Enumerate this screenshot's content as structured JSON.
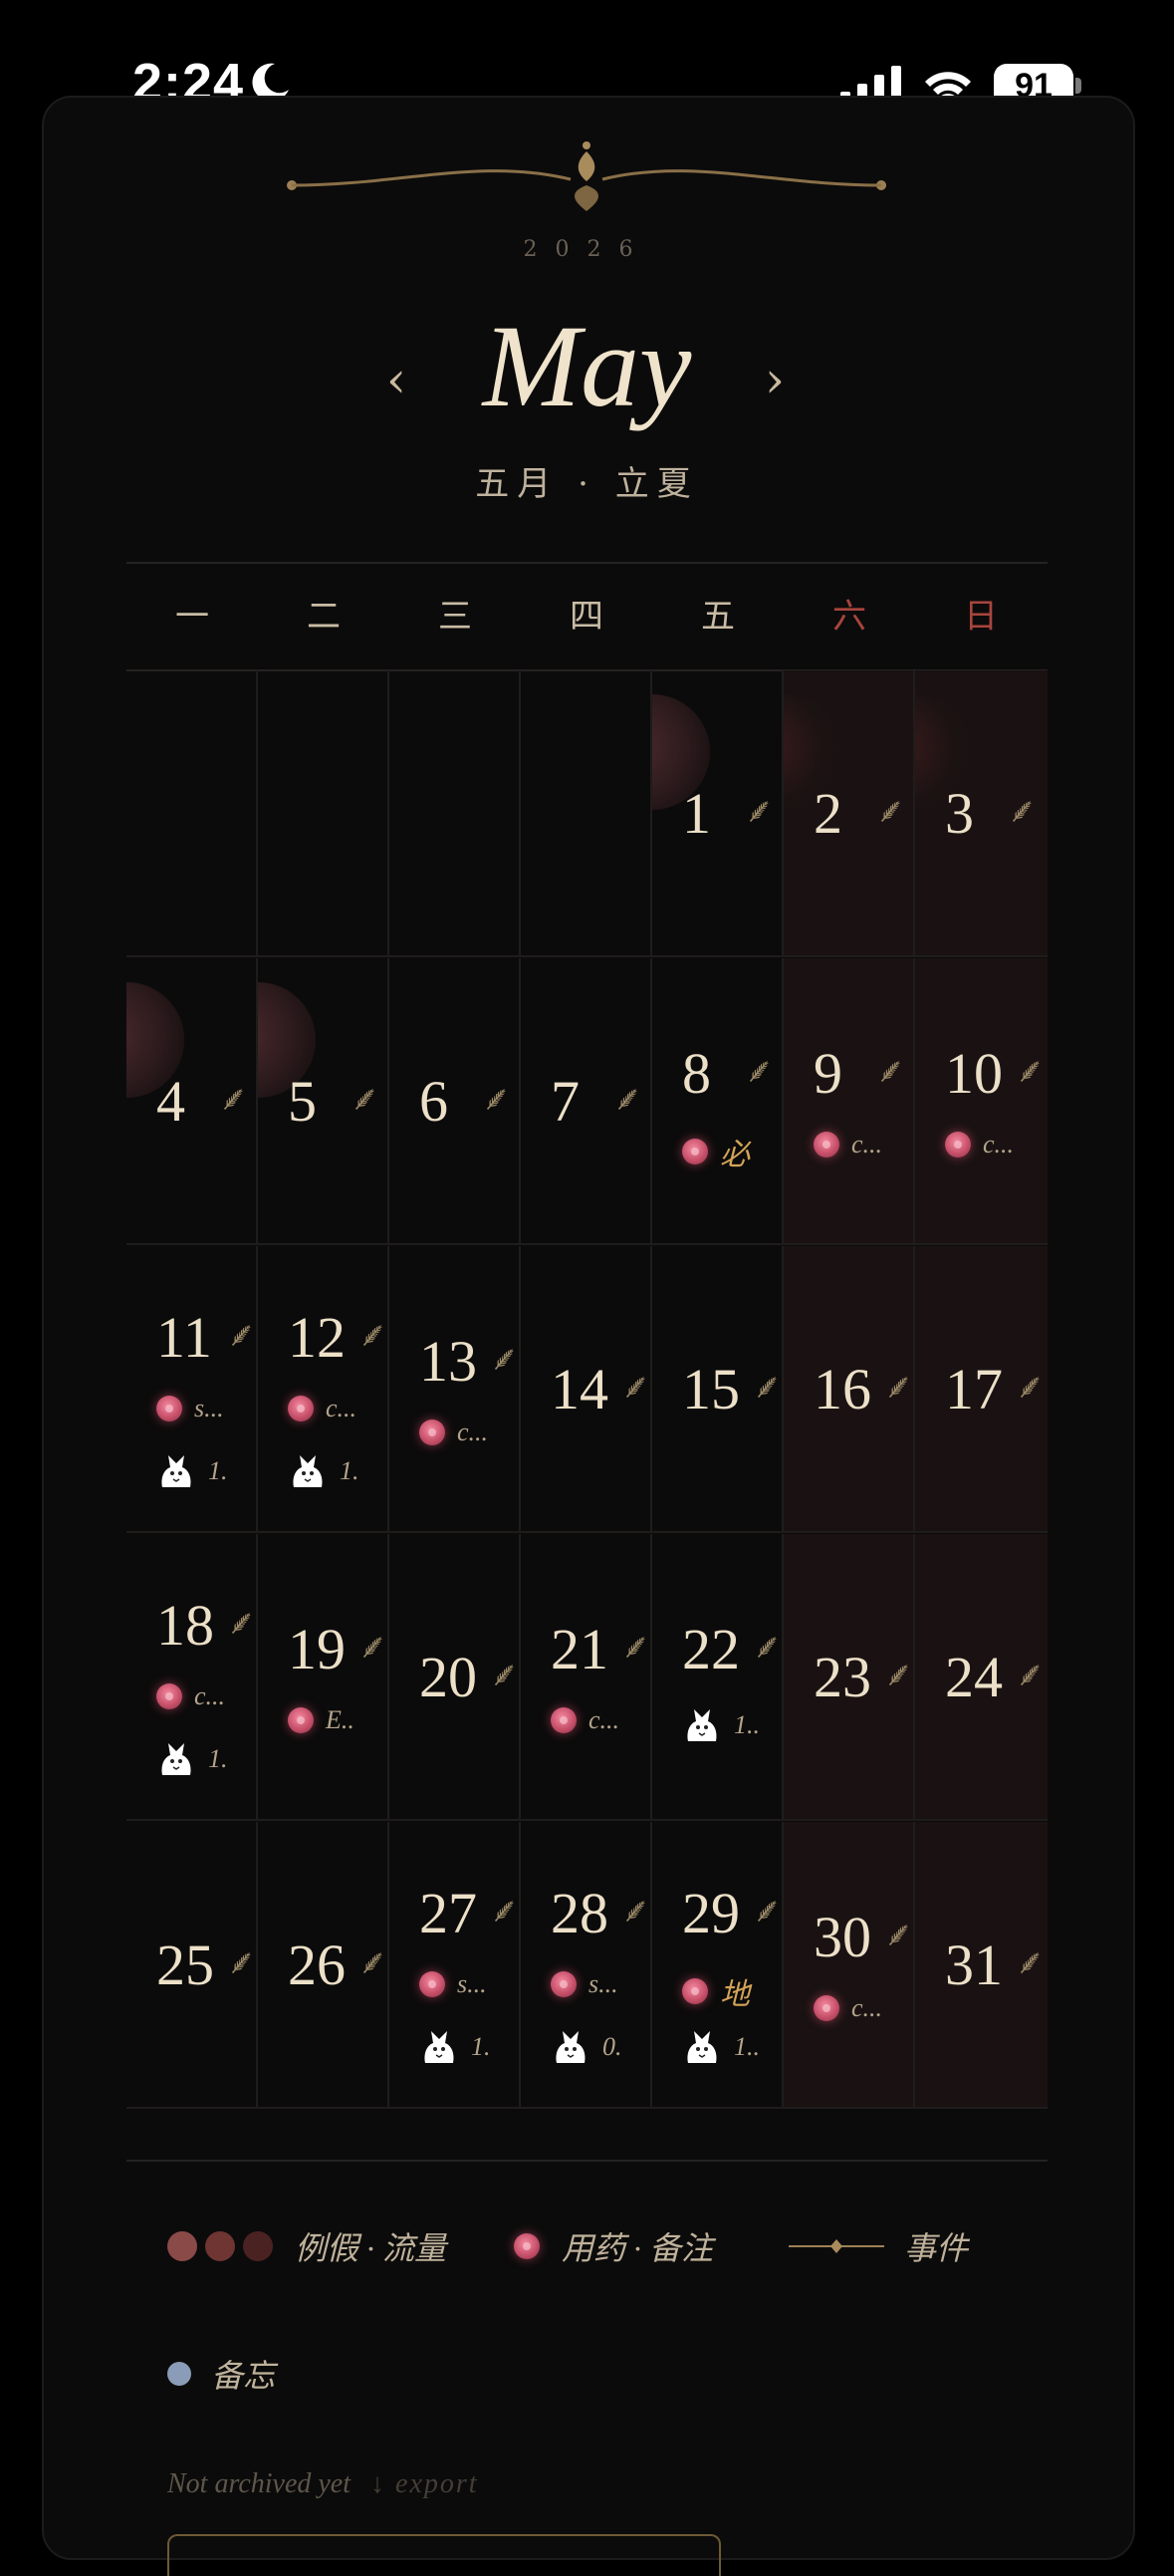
{
  "status_bar": {
    "time": "2:24",
    "battery": "91"
  },
  "calendar": {
    "year": "2026",
    "month": "May",
    "subtitle": "五月 · 立夏",
    "prev": "‹",
    "next": "›",
    "weekdays": [
      "一",
      "二",
      "三",
      "四",
      "五",
      "六",
      "日"
    ],
    "days": [
      {
        "d": "1",
        "tags": []
      },
      {
        "d": "2",
        "tags": []
      },
      {
        "d": "3",
        "tags": []
      },
      {
        "d": "4",
        "tags": []
      },
      {
        "d": "5",
        "tags": []
      },
      {
        "d": "6",
        "tags": []
      },
      {
        "d": "7",
        "tags": []
      },
      {
        "d": "8",
        "tags": [
          {
            "type": "med",
            "text": "必"
          }
        ]
      },
      {
        "d": "9",
        "tags": [
          {
            "type": "med",
            "text": "c..."
          }
        ]
      },
      {
        "d": "10",
        "tags": [
          {
            "type": "med",
            "text": "c..."
          }
        ]
      },
      {
        "d": "11",
        "tags": [
          {
            "type": "med",
            "text": "s..."
          },
          {
            "type": "fox",
            "text": "1."
          }
        ]
      },
      {
        "d": "12",
        "tags": [
          {
            "type": "med",
            "text": "c..."
          },
          {
            "type": "fox",
            "text": "1."
          }
        ]
      },
      {
        "d": "13",
        "tags": [
          {
            "type": "med",
            "text": "c..."
          }
        ]
      },
      {
        "d": "14",
        "tags": []
      },
      {
        "d": "15",
        "tags": []
      },
      {
        "d": "16",
        "tags": []
      },
      {
        "d": "17",
        "tags": []
      },
      {
        "d": "18",
        "tags": [
          {
            "type": "med",
            "text": "c..."
          },
          {
            "type": "fox",
            "text": "1."
          }
        ]
      },
      {
        "d": "19",
        "tags": [
          {
            "type": "med",
            "text": "E.."
          }
        ]
      },
      {
        "d": "20",
        "tags": []
      },
      {
        "d": "21",
        "tags": [
          {
            "type": "med",
            "text": "c..."
          }
        ]
      },
      {
        "d": "22",
        "tags": [
          {
            "type": "fox",
            "text": "1.."
          }
        ]
      },
      {
        "d": "23",
        "tags": []
      },
      {
        "d": "24",
        "tags": []
      },
      {
        "d": "25",
        "tags": []
      },
      {
        "d": "26",
        "tags": []
      },
      {
        "d": "27",
        "tags": [
          {
            "type": "med",
            "text": "s..."
          },
          {
            "type": "fox",
            "text": "1."
          }
        ]
      },
      {
        "d": "28",
        "tags": [
          {
            "type": "med",
            "text": "s..."
          },
          {
            "type": "fox",
            "text": "0."
          }
        ]
      },
      {
        "d": "29",
        "tags": [
          {
            "type": "med",
            "text": "地"
          },
          {
            "type": "fox",
            "text": "1.."
          }
        ]
      },
      {
        "d": "30",
        "tags": [
          {
            "type": "med",
            "text": "c..."
          }
        ]
      },
      {
        "d": "31",
        "tags": []
      }
    ]
  },
  "legend": {
    "period": "例假 · 流量",
    "meds": "用药 · 备注",
    "event": "事件",
    "memo": "备忘",
    "colors": {
      "period": [
        "#8a4a48",
        "#6e3532",
        "#4b2222"
      ],
      "memo": "#8a9cb7"
    }
  },
  "footer": {
    "note": "Not archived yet",
    "export": "↓ export"
  }
}
